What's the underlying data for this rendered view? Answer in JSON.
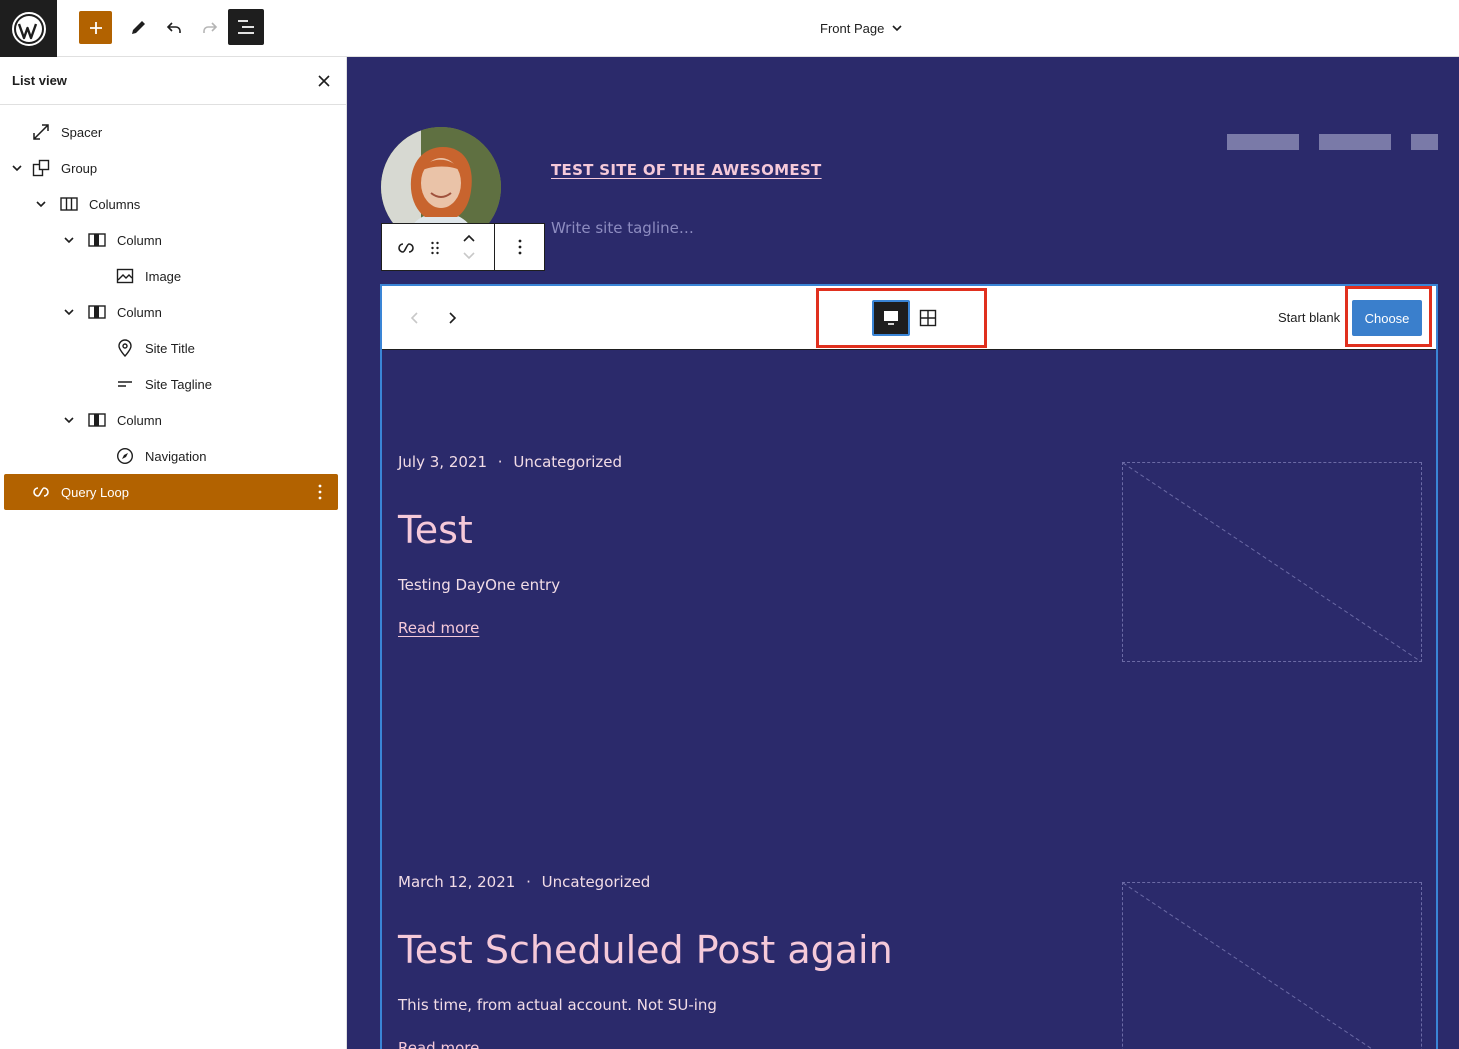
{
  "header": {
    "document_title": "Front Page",
    "icons": [
      "wordpress-logo-icon",
      "plus-icon",
      "pencil-icon",
      "undo-icon",
      "redo-icon",
      "list-view-icon",
      "chevron-down-icon"
    ]
  },
  "sidebar": {
    "title": "List view",
    "items": [
      {
        "label": "Spacer",
        "icon": "spacer-icon",
        "expandable": false
      },
      {
        "label": "Group",
        "icon": "group-icon",
        "expandable": true
      },
      {
        "label": "Columns",
        "icon": "columns-icon",
        "expandable": true
      },
      {
        "label": "Column",
        "icon": "column-icon",
        "expandable": true
      },
      {
        "label": "Image",
        "icon": "image-icon",
        "expandable": false
      },
      {
        "label": "Column",
        "icon": "column-icon",
        "expandable": true
      },
      {
        "label": "Site Title",
        "icon": "map-pin-icon",
        "expandable": false
      },
      {
        "label": "Site Tagline",
        "icon": "tagline-icon",
        "expandable": false
      },
      {
        "label": "Column",
        "icon": "column-icon",
        "expandable": true
      },
      {
        "label": "Navigation",
        "icon": "compass-icon",
        "expandable": false
      },
      {
        "label": "Query Loop",
        "icon": "loop-icon",
        "expandable": false,
        "selected": true
      }
    ]
  },
  "canvas": {
    "background": "#2b2a6b",
    "site_title": "TEST SITE OF THE AWESOMEST",
    "site_tagline_placeholder": "Write site tagline…",
    "query_loop_setup": {
      "start_blank_label": "Start blank",
      "choose_label": "Choose",
      "modes": [
        "carousel",
        "grid"
      ],
      "active_mode": "carousel"
    },
    "posts": [
      {
        "date": "July 3, 2021",
        "separator": "·",
        "category": "Uncategorized",
        "title": "Test",
        "excerpt": "Testing DayOne entry",
        "read_more": "Read more"
      },
      {
        "date": "March 12, 2021",
        "separator": "·",
        "category": "Uncategorized",
        "title": "Test Scheduled Post again",
        "excerpt": "This time, from actual account. Not SU-ing",
        "read_more": "Read more"
      }
    ]
  },
  "colors": {
    "accent_orange": "#b26200",
    "highlight_red": "#e0301e",
    "choose_blue": "#3a7fcc",
    "title_pink": "#f5c9d9"
  }
}
